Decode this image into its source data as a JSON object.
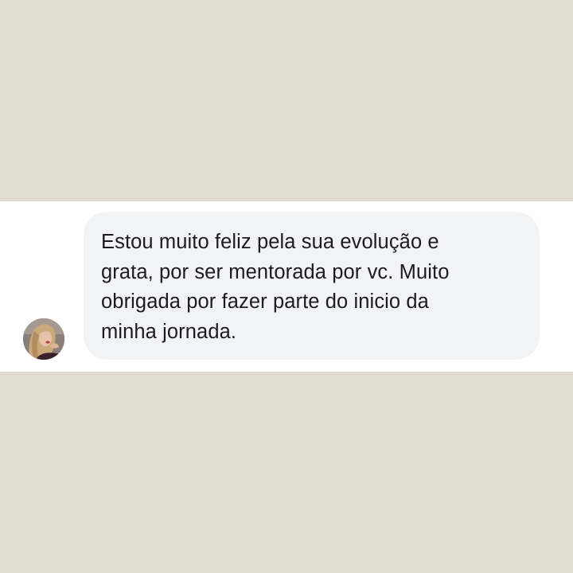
{
  "chat": {
    "message": {
      "text": "Estou muito feliz pela sua evolução e\ngrata, por ser mentorada por vc. Muito\nobrigada por fazer parte do inicio da\nminha jornada."
    },
    "avatar": {
      "icon": "profile-photo"
    }
  },
  "colors": {
    "page_background": "#e3dcd2",
    "strip_background": "#ffffff",
    "bubble_background": "#f2f3f5",
    "text": "#1c1c1e"
  }
}
